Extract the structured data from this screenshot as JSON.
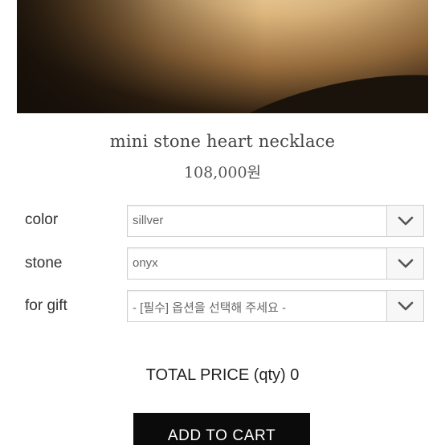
{
  "product": {
    "name": "mini stone heart necklace",
    "price": "108,000원"
  },
  "options": {
    "color": {
      "label": "color",
      "selected": "sillver"
    },
    "stone": {
      "label": "stone",
      "selected": "onyx"
    },
    "gift": {
      "label": "for gift",
      "selected": "- [필수] 옵션을 선택해 주세요 -"
    }
  },
  "total": {
    "text": "TOTAL PRICE (qty) 0"
  },
  "cart": {
    "button_label": "ADD TO CART"
  },
  "icons": {
    "dropdown": "chevron-down-icon"
  },
  "colors": {
    "button_bg": "#0b0b0b",
    "button_text": "#ffffff"
  }
}
